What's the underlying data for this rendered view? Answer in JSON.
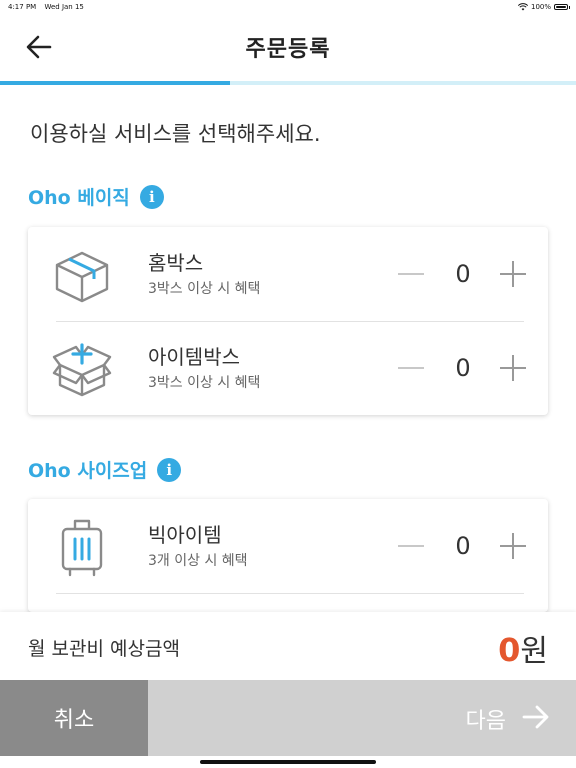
{
  "status_bar": {
    "time": "4:17 PM",
    "date": "Wed Jan 15",
    "battery": "100%"
  },
  "header": {
    "title": "주문등록"
  },
  "progress": {
    "fraction": 0.4
  },
  "prompt": "이용하실 서비스를 선택해주세요.",
  "sections": [
    {
      "title": "Oho 베이직",
      "items": [
        {
          "name": "홈박스",
          "subtitle": "3박스 이상 시 혜택",
          "quantity": "0",
          "icon": "home-box-icon"
        },
        {
          "name": "아이템박스",
          "subtitle": "3박스 이상 시 혜택",
          "quantity": "0",
          "icon": "item-box-icon"
        }
      ]
    },
    {
      "title": "Oho 사이즈업",
      "items": [
        {
          "name": "빅아이템",
          "subtitle": "3개 이상 시 혜택",
          "quantity": "0",
          "icon": "suitcase-icon"
        }
      ]
    }
  ],
  "summary": {
    "label": "월 보관비 예상금액",
    "amount": "0",
    "unit": "원"
  },
  "actions": {
    "cancel": "취소",
    "next": "다음"
  },
  "colors": {
    "accent": "#35aae2",
    "amount": "#e4572e",
    "cancel_bg": "#8a8a8a",
    "next_bg": "#d0d0d0"
  }
}
